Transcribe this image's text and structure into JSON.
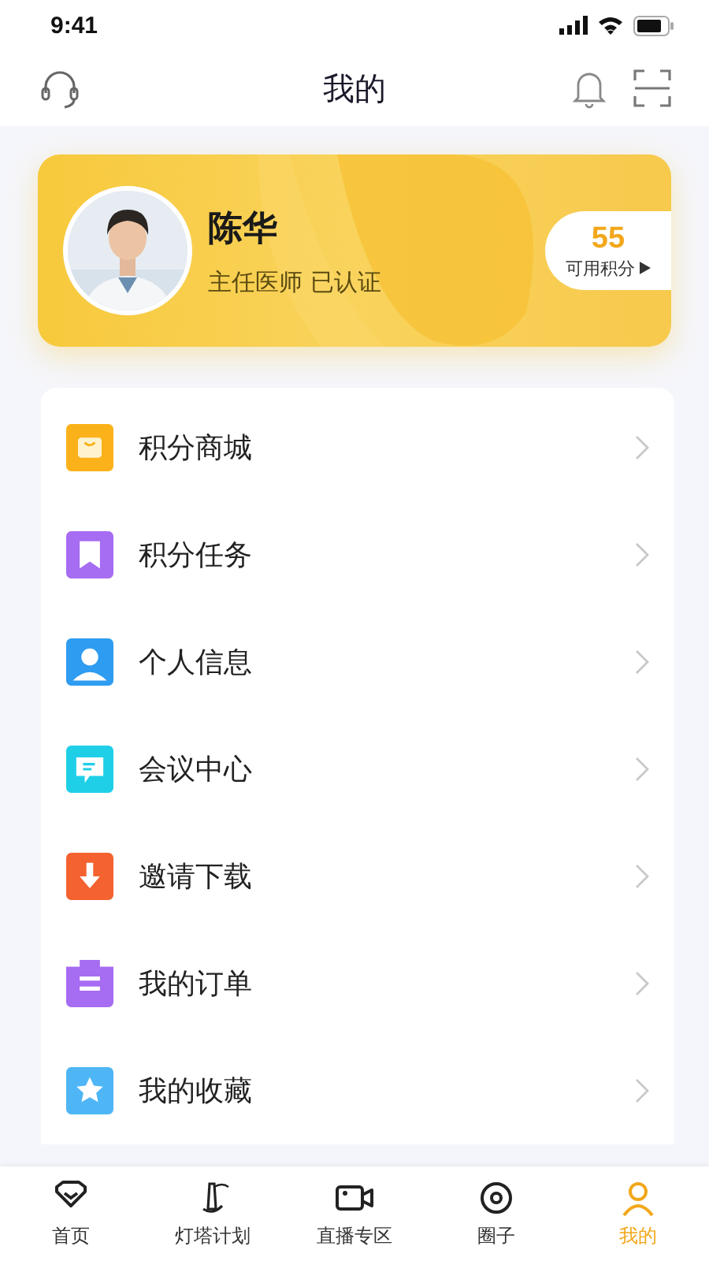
{
  "status_bar": {
    "time": "9:41"
  },
  "header": {
    "title": "我的"
  },
  "profile": {
    "name": "陈华",
    "role": "主任医师 已认证",
    "points": "55",
    "points_label": "可用积分"
  },
  "menu": [
    {
      "label": "积分商城",
      "kind": "bag",
      "color": "#fbb21a"
    },
    {
      "label": "积分任务",
      "kind": "bookmark",
      "color": "#a66cf2"
    },
    {
      "label": "个人信息",
      "kind": "person",
      "color": "#2e9cf0"
    },
    {
      "label": "会议中心",
      "kind": "chat",
      "color": "#1fcfe8"
    },
    {
      "label": "邀请下载",
      "kind": "download",
      "color": "#f4622f"
    },
    {
      "label": "我的订单",
      "kind": "order",
      "color": "#a66cf2"
    },
    {
      "label": "我的收藏",
      "kind": "star",
      "color": "#4fb6f6"
    }
  ],
  "tabs": [
    {
      "label": "首页",
      "kind": "home",
      "selected": false
    },
    {
      "label": "灯塔计划",
      "kind": "tower",
      "selected": false
    },
    {
      "label": "直播专区",
      "kind": "video",
      "selected": false
    },
    {
      "label": "圈子",
      "kind": "circle",
      "selected": false
    },
    {
      "label": "我的",
      "kind": "me",
      "selected": true
    }
  ]
}
